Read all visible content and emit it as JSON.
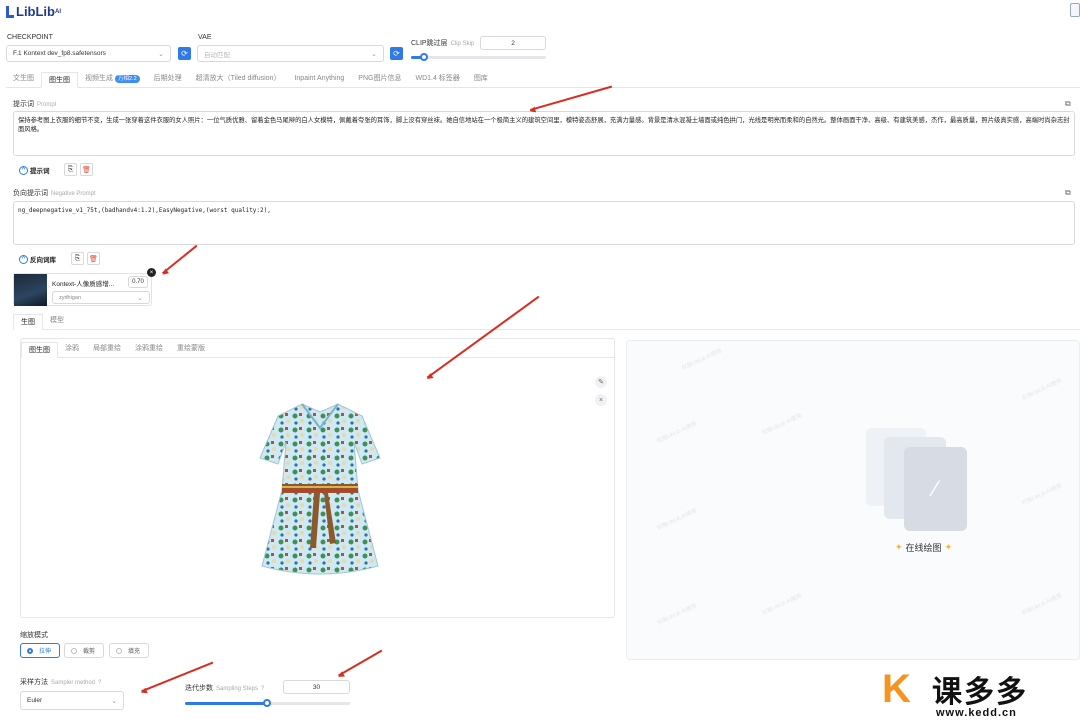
{
  "app": {
    "logo_text": "LibLib",
    "logo_sup": "AI"
  },
  "checkpoint": {
    "label": "CHECKPOINT",
    "value": "F.1 Kontext dev_fp8.safetensors"
  },
  "vae": {
    "label": "VAE",
    "placeholder": "自动匹配"
  },
  "clip": {
    "label": "CLIP跳过层",
    "sublabel": "Clip Skip",
    "value": "2",
    "level": 0.1
  },
  "tabs": [
    {
      "label": "文生图"
    },
    {
      "label": "图生图"
    },
    {
      "label": "视频生成",
      "badge": "万相2.2"
    },
    {
      "label": "后期处理"
    },
    {
      "label": "超清放大（Tiled diffusion）"
    },
    {
      "label": "Inpaint Anything"
    },
    {
      "label": "PNG图片信息"
    },
    {
      "label": "WD1.4 标签器"
    },
    {
      "label": "图库"
    }
  ],
  "prompt": {
    "label": "提示词",
    "sublabel": "Prompt",
    "text": "保持参考图上衣服的细节不变，生成一张穿着这件衣服的女人照片：一位气质优雅、留着金色马尾辫的白人女模特，佩戴着夸张的耳饰，脚上没有穿丝袜。她自信地站在一个极简主义的建筑空间里，模特姿态舒展，充满力量感。背景是清水混凝土墙面或纯色拱门，光线是明亮而柔和的自然光。整体画面干净、高级、有建筑美感，杰作，最高质量，照片级真实感，高端时尚杂志封面风格。",
    "library_btn": "提示词"
  },
  "negative": {
    "label": "负向提示词",
    "sublabel": "Negative Prompt",
    "text": "ng_deepnegative_v1_75t,(badhandv4:1.2),EasyNegative,(worst quality:2),",
    "library_btn": "反向词库"
  },
  "lora": {
    "name": "Kontext-人像质感增...",
    "weight": "0.70",
    "trigger": "zydhigan"
  },
  "model_tabs": [
    {
      "label": "生图"
    },
    {
      "label": "模型"
    }
  ],
  "img_tabs": [
    {
      "label": "图生图"
    },
    {
      "label": "涂鸦"
    },
    {
      "label": "局部重绘"
    },
    {
      "label": "涂鸦重绘"
    },
    {
      "label": "重绘蒙版"
    }
  ],
  "output": {
    "label": "在线绘图",
    "watermark": "仅限LibLib AI使用"
  },
  "resize": {
    "label": "缩放模式",
    "options": [
      {
        "label": "拉伸"
      },
      {
        "label": "裁剪"
      },
      {
        "label": "填充"
      }
    ],
    "selected": "拉伸"
  },
  "sampler": {
    "label": "采样方法",
    "sublabel": "Sampler method",
    "value": "Euler"
  },
  "steps": {
    "label": "迭代步数",
    "sublabel": "Sampling Steps",
    "value": "30",
    "level": 0.5
  },
  "brand": {
    "name": "课多多",
    "url": "www.kedd.cn"
  },
  "colors": {
    "accent": "#2f7ae5",
    "annotation": "#d92d20",
    "brand_orange": "#f7931e"
  }
}
